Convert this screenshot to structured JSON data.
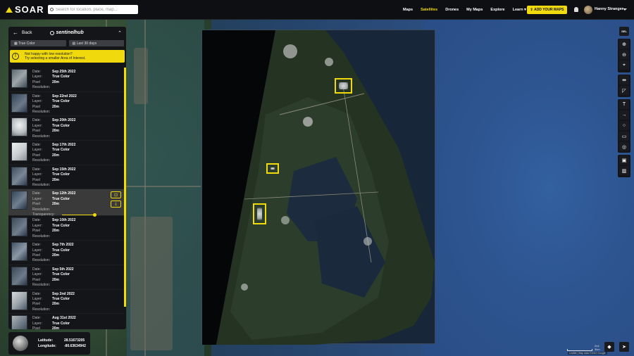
{
  "app": {
    "logo_text": "SOAR"
  },
  "search": {
    "placeholder": "Search for location, place, map..."
  },
  "nav": [
    {
      "label": "Maps",
      "active": false
    },
    {
      "label": "Satellites",
      "active": true
    },
    {
      "label": "Drones",
      "active": false
    },
    {
      "label": "My Maps",
      "active": false
    },
    {
      "label": "Explore",
      "active": false
    },
    {
      "label": "Learn",
      "active": false
    }
  ],
  "add_button": "ADD YOUR MAPS",
  "user": {
    "name": "Hanny Stranger"
  },
  "panel": {
    "back_label": "Back",
    "provider": "sentinelhub",
    "filter_layer": "True Color",
    "filter_range": "Last 30 days",
    "notice_line1": "Not happy with low resolution?",
    "notice_line2": "Try selecting a smaller Area of Interest.",
    "labels": {
      "date": "Date:",
      "layer": "Layer:",
      "resolution": "Pixel Resolution:",
      "transparency": "Transparency:"
    },
    "transparency_level": 1.0,
    "items": [
      {
        "date": "Sep 25th 2022",
        "layer": "True Color",
        "resolution": "20m",
        "selected": false
      },
      {
        "date": "Sep 22nd 2022",
        "layer": "True Color",
        "resolution": "20m",
        "selected": false
      },
      {
        "date": "Sep 20th 2022",
        "layer": "True Color",
        "resolution": "20m",
        "selected": false
      },
      {
        "date": "Sep 17th 2022",
        "layer": "True Color",
        "resolution": "20m",
        "selected": false
      },
      {
        "date": "Sep 15th 2022",
        "layer": "True Color",
        "resolution": "20m",
        "selected": false
      },
      {
        "date": "Sep 12th 2022",
        "layer": "True Color",
        "resolution": "20m",
        "selected": true
      },
      {
        "date": "Sep 10th 2022",
        "layer": "True Color",
        "resolution": "20m",
        "selected": false
      },
      {
        "date": "Sep 7th 2022",
        "layer": "True Color",
        "resolution": "20m",
        "selected": false
      },
      {
        "date": "Sep 5th 2022",
        "layer": "True Color",
        "resolution": "20m",
        "selected": false
      },
      {
        "date": "Sep 2nd 2022",
        "layer": "True Color",
        "resolution": "20m",
        "selected": false
      },
      {
        "date": "Aug 31st 2022",
        "layer": "True Color",
        "resolution": "20m",
        "selected": false
      }
    ]
  },
  "coords": {
    "lat_label": "Latitude:",
    "lat": "28.51673205",
    "lon_label": "Longitude:",
    "lon": "-80.63634942"
  },
  "toolbar": {
    "top": "SEL",
    "icons": [
      "zoom-in-icon",
      "zoom-out-icon",
      "fit-icon",
      "measure-icon",
      "draw-area-icon",
      "text-icon",
      "arrow-icon",
      "circle-icon",
      "rectangle-icon",
      "point-icon",
      "save-icon",
      "trash-icon"
    ]
  },
  "scale": {
    "label_top": "2mi",
    "label_bottom": "3km"
  },
  "attribution": "Leaflet | Map data ©2022 Google",
  "colors": {
    "accent": "#f0d90d",
    "panel": "#141518"
  }
}
